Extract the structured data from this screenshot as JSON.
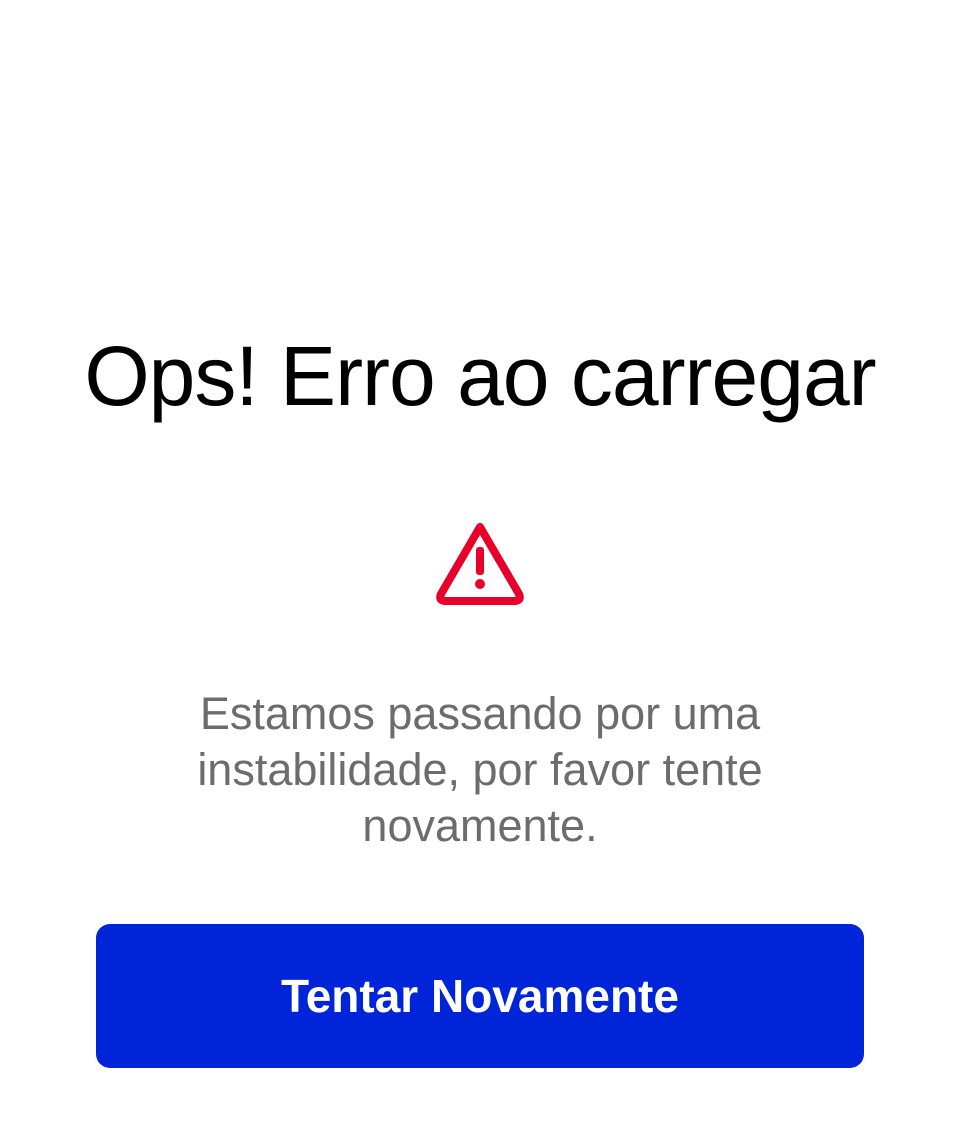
{
  "error_screen": {
    "title": "Ops! Erro ao carregar",
    "icon": "warning-triangle-icon",
    "message": "Estamos passando por uma instabilidade, por favor tente novamente.",
    "retry_label": "Tentar Novamente"
  },
  "colors": {
    "warning": "#e8002a",
    "button": "#0025d8",
    "message_text": "#6c6c6c"
  }
}
